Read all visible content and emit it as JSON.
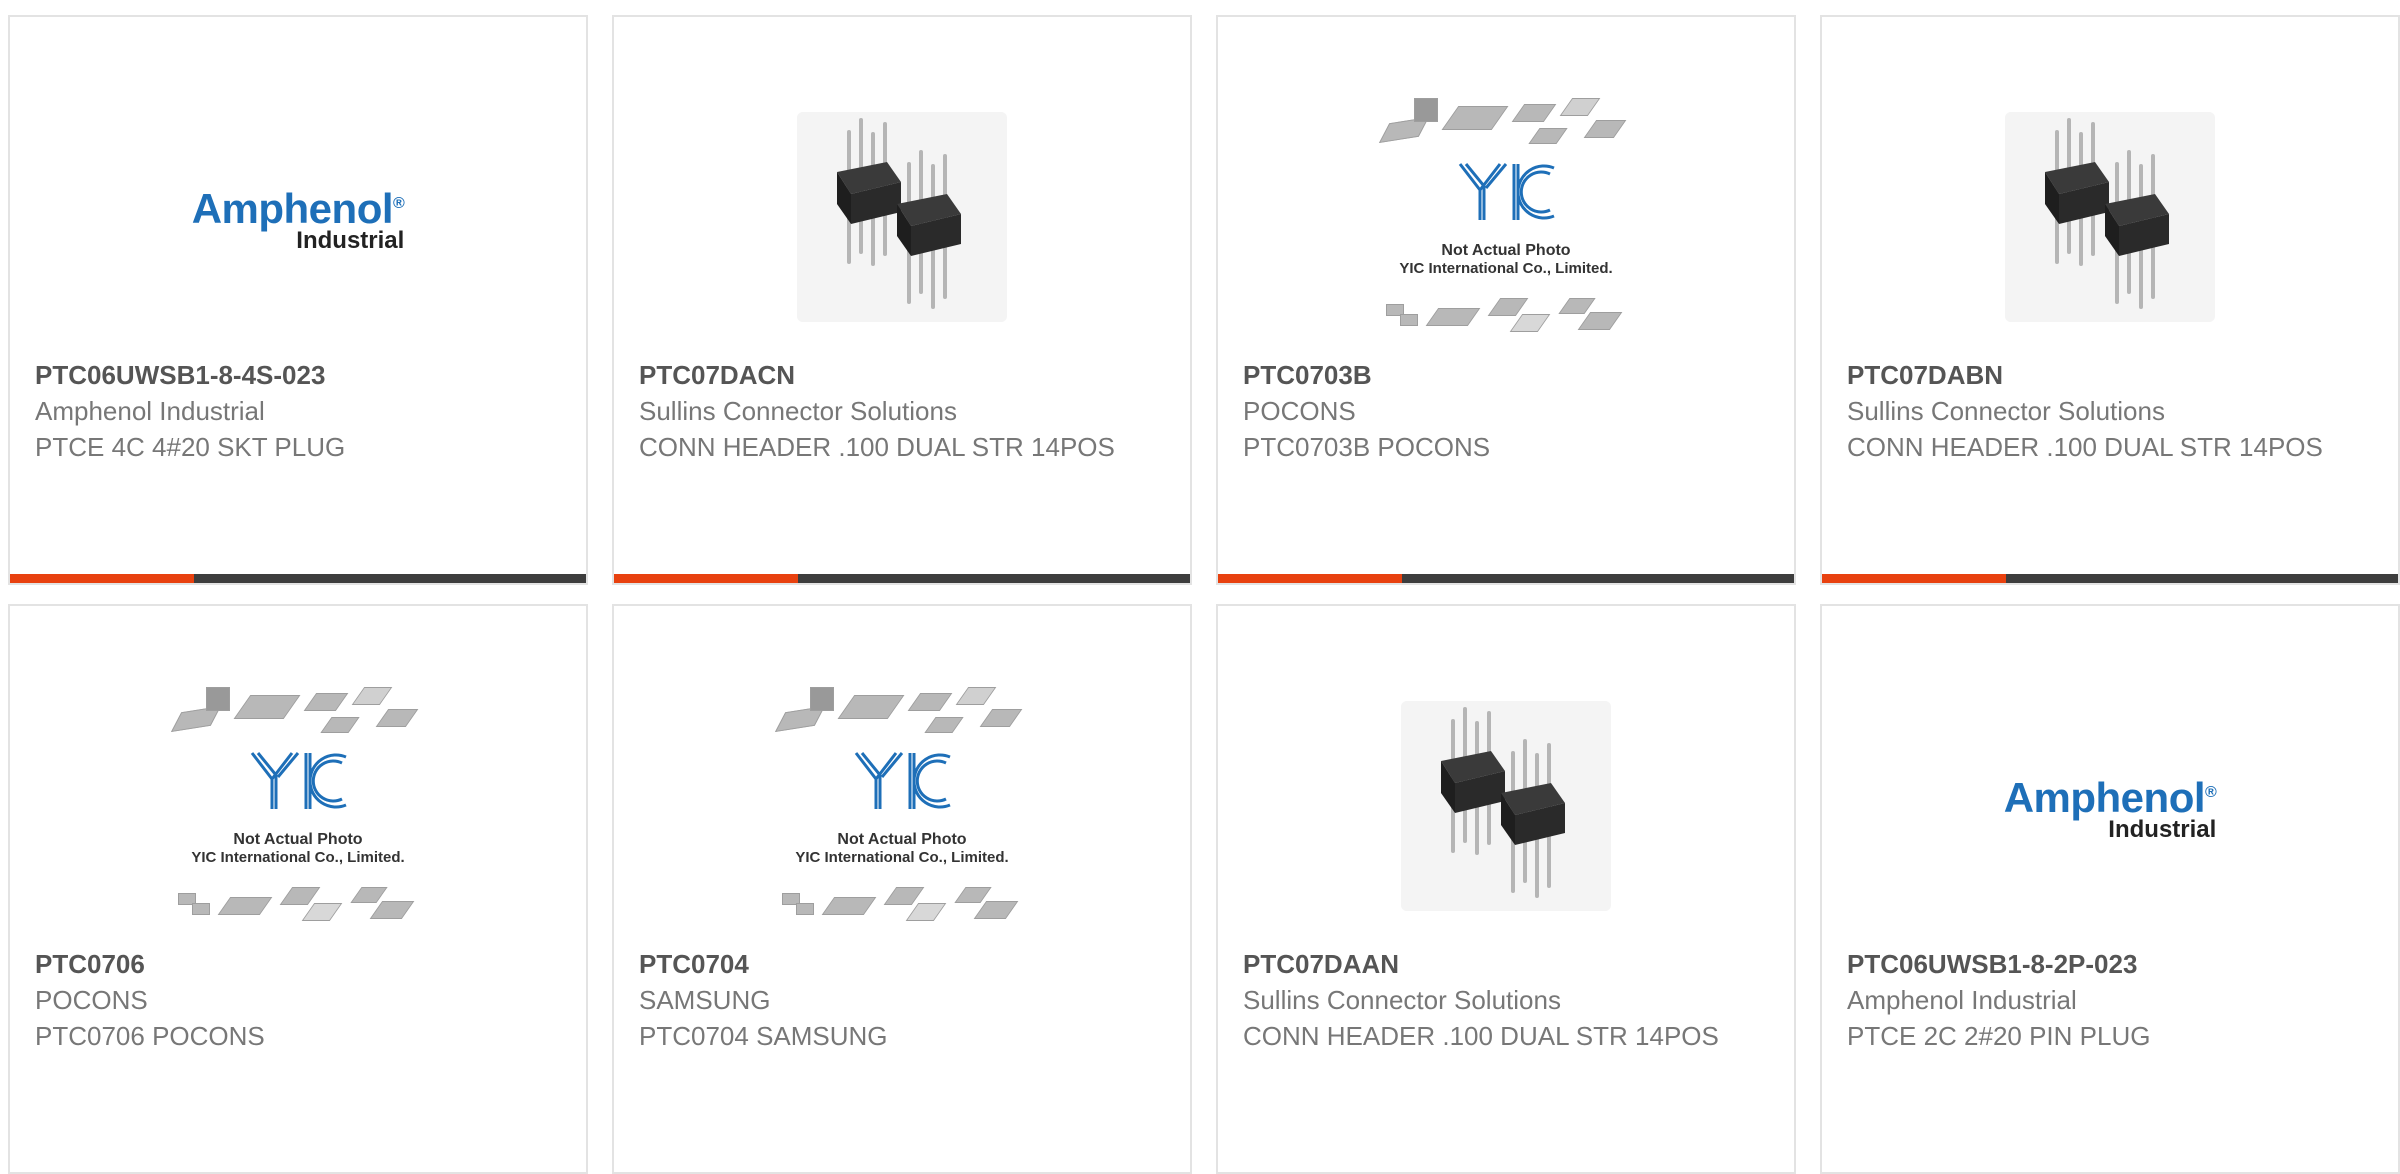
{
  "accent_color": "#e8410f",
  "bar_color": "#3d3d3d",
  "products": [
    {
      "part_number": "PTC06UWSB1-8-4S-023",
      "manufacturer": "Amphenol Industrial",
      "description": "PTCE 4C 4#20 SKT PLUG",
      "image": "amphenol-logo",
      "logo_text": "Amphenol",
      "logo_sub": "Industrial"
    },
    {
      "part_number": "PTC07DACN",
      "manufacturer": "Sullins Connector Solutions",
      "description": "CONN HEADER .100 DUAL STR 14POS",
      "image": "pin-header-photo"
    },
    {
      "part_number": "PTC0703B",
      "manufacturer": "POCONS",
      "description": "PTC0703B POCONS",
      "image": "yic-placeholder",
      "placeholder_line1": "Not Actual Photo",
      "placeholder_line2": "YIC International Co., Limited."
    },
    {
      "part_number": "PTC07DABN",
      "manufacturer": "Sullins Connector Solutions",
      "description": "CONN HEADER .100 DUAL STR 14POS",
      "image": "pin-header-photo"
    },
    {
      "part_number": "PTC0706",
      "manufacturer": "POCONS",
      "description": "PTC0706 POCONS",
      "image": "yic-placeholder",
      "placeholder_line1": "Not Actual Photo",
      "placeholder_line2": "YIC International Co., Limited."
    },
    {
      "part_number": "PTC0704",
      "manufacturer": "SAMSUNG",
      "description": "PTC0704 SAMSUNG",
      "image": "yic-placeholder",
      "placeholder_line1": "Not Actual Photo",
      "placeholder_line2": "YIC International Co., Limited."
    },
    {
      "part_number": "PTC07DAAN",
      "manufacturer": "Sullins Connector Solutions",
      "description": "CONN HEADER .100 DUAL STR 14POS",
      "image": "pin-header-photo"
    },
    {
      "part_number": "PTC06UWSB1-8-2P-023",
      "manufacturer": "Amphenol Industrial",
      "description": "PTCE 2C 2#20 PIN PLUG",
      "image": "amphenol-logo",
      "logo_text": "Amphenol",
      "logo_sub": "Industrial"
    }
  ]
}
